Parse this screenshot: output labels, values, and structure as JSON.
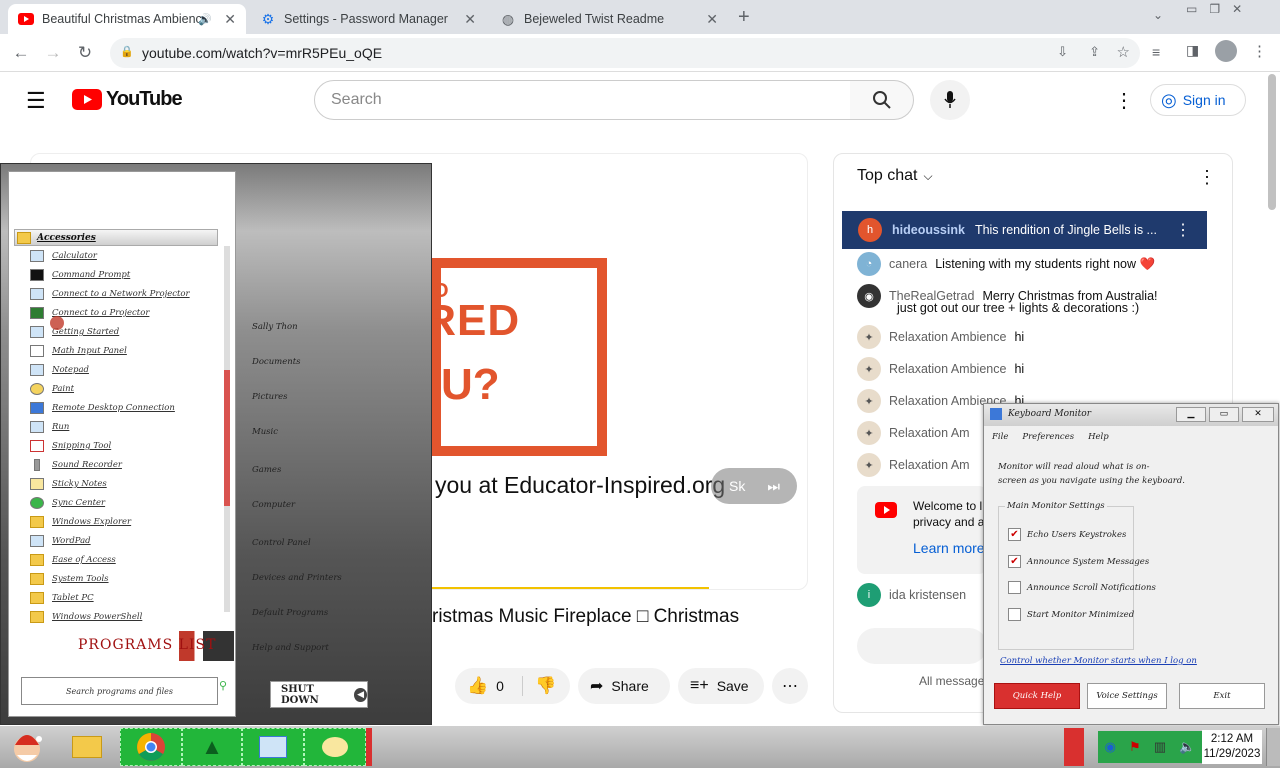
{
  "browser": {
    "tabs": [
      {
        "title": "Beautiful Christmas Ambienc",
        "icon": "youtube-icon"
      },
      {
        "title": "Settings - Password Manager",
        "icon": "gear-icon"
      },
      {
        "title": "Bejeweled Twist Readme",
        "icon": "globe-icon"
      }
    ],
    "url": "youtube.com/watch?v=mrR5PEu_oQE"
  },
  "youtube": {
    "logo": "YouTube",
    "search_placeholder": "Search",
    "signin": "Sign in",
    "video": {
      "banner_top": "IRED",
      "banner_bottom": "U?",
      "banner_left": "O",
      "caption": "you at Educator-Inspired.org",
      "skip_label": "Sk",
      "title": "ristmas Music Fireplace □ Christmas",
      "likes": "0",
      "share": "Share",
      "save": "Save"
    },
    "chat": {
      "header": "Top chat",
      "pinned": {
        "name": "hideoussink",
        "text": "This rendition of Jingle Bells is ..."
      },
      "messages": [
        {
          "name": "canera",
          "text": "Listening with my students right now ❤️"
        },
        {
          "name": "TheRealGetrad",
          "text": "Merry Christmas from Australia!",
          "text2": "just got out our tree + lights & decorations :)"
        },
        {
          "name": "Relaxation Ambience",
          "text": "hi"
        },
        {
          "name": "Relaxation Ambience",
          "text": "hi"
        },
        {
          "name": "Relaxation Ambience",
          "text": "hi"
        },
        {
          "name": "Relaxation Am",
          "text": ""
        },
        {
          "name": "Relaxation Am",
          "text": ""
        }
      ],
      "welcome": "Welcome to l",
      "welcome2": "privacy and a",
      "learn_more": "Learn more",
      "last_name": "ida kristensen",
      "all_messages": "All message"
    }
  },
  "startmenu": {
    "folder": "Accessories",
    "items": [
      "Calculator",
      "Command Prompt",
      "Connect to a Network Projector",
      "Connect to a Projector",
      "Getting Started",
      "Math Input Panel",
      "Notepad",
      "Paint",
      "Remote Desktop Connection",
      "Run",
      "Snipping Tool",
      "Sound Recorder",
      "Sticky Notes",
      "Sync Center",
      "Windows Explorer",
      "WordPad",
      "Ease of Access",
      "System Tools",
      "Tablet PC",
      "Windows PowerShell"
    ],
    "programs_list": "PROGRAMS LIST",
    "search_placeholder": "Search programs and files",
    "right_items": [
      "Sally Thon",
      "Documents",
      "Pictures",
      "Music",
      "Games",
      "Computer",
      "Control Panel",
      "Devices and Printers",
      "Default Programs",
      "Help and Support"
    ],
    "shutdown": "SHUT DOWN"
  },
  "keyboard_monitor": {
    "title": "Keyboard Monitor",
    "menu": [
      "File",
      "Preferences",
      "Help"
    ],
    "desc1": "Monitor will read aloud what is on-",
    "desc2": "screen as you navigate using the keyboard.",
    "group_label": "Main Monitor Settings",
    "options": [
      {
        "label": "Echo Users Keystrokes",
        "checked": true
      },
      {
        "label": "Announce System Messages",
        "checked": true
      },
      {
        "label": "Announce Scroll Notifications",
        "checked": false
      },
      {
        "label": "Start Monitor Minimized",
        "checked": false
      }
    ],
    "link": "Control whether Monitor starts when I log on",
    "buttons": [
      "Quick Help",
      "Voice Settings",
      "Exit"
    ]
  },
  "taskbar": {
    "time": "2:12 AM",
    "date": "11/29/2023"
  }
}
